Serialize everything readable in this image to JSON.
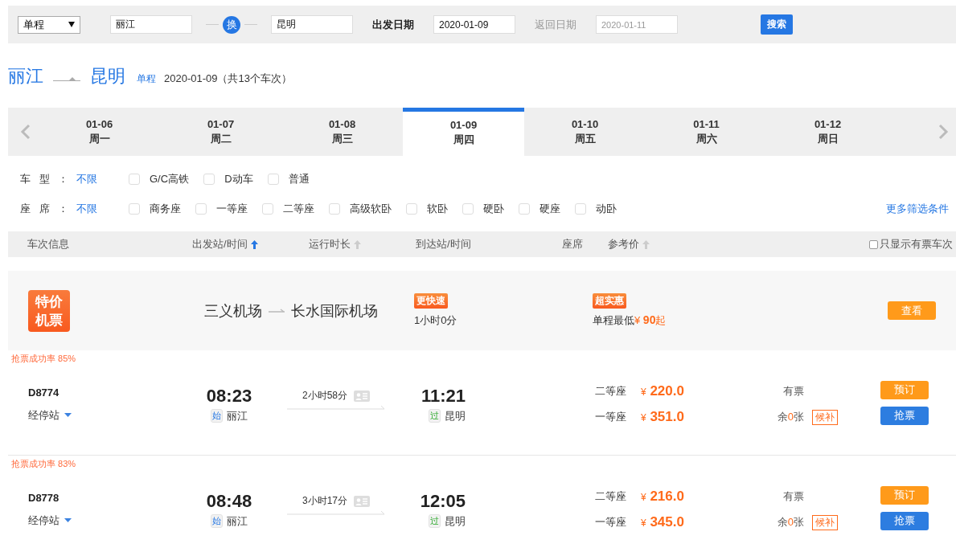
{
  "search_bar": {
    "trip_type": "单程",
    "from": "丽江",
    "swap": "换",
    "to": "昆明",
    "depart_label": "出发日期",
    "depart_date": "2020-01-09",
    "return_label": "返回日期",
    "return_date": "2020-01-11",
    "return_disabled": true,
    "search_button": "搜索"
  },
  "route": {
    "from": "丽江",
    "to": "昆明",
    "trip_type": "单程",
    "summary": "2020-01-09（共13个车次）"
  },
  "dates": [
    {
      "date": "01-06",
      "weekday": "周一",
      "selected": false
    },
    {
      "date": "01-07",
      "weekday": "周二",
      "selected": false
    },
    {
      "date": "01-08",
      "weekday": "周三",
      "selected": false
    },
    {
      "date": "01-09",
      "weekday": "周四",
      "selected": true
    },
    {
      "date": "01-10",
      "weekday": "周五",
      "selected": false
    },
    {
      "date": "01-11",
      "weekday": "周六",
      "selected": false
    },
    {
      "date": "01-12",
      "weekday": "周日",
      "selected": false
    }
  ],
  "filters": [
    {
      "label": "车型：",
      "value": "不限",
      "options": [
        {
          "label": "G/C高铁",
          "checked": false
        },
        {
          "label": "D动车",
          "checked": false
        },
        {
          "label": "普通",
          "checked": false
        }
      ]
    },
    {
      "label": "座席：",
      "value": "不限",
      "options": [
        {
          "label": "商务座",
          "checked": false
        },
        {
          "label": "一等座",
          "checked": false
        },
        {
          "label": "二等座",
          "checked": false
        },
        {
          "label": "高级软卧",
          "checked": false
        },
        {
          "label": "软卧",
          "checked": false
        },
        {
          "label": "硬卧",
          "checked": false
        },
        {
          "label": "硬座",
          "checked": false
        },
        {
          "label": "动卧",
          "checked": false
        }
      ],
      "more": "更多筛选条件"
    }
  ],
  "table_header": {
    "columns": [
      {
        "label": "车次信息"
      },
      {
        "label": "出发站/时间",
        "sort_active": true
      },
      {
        "label": "运行时长",
        "sort_active": false
      },
      {
        "label": "到达站/时间"
      },
      {
        "label": "座席"
      },
      {
        "label": "参考价",
        "sort_active": false
      }
    ],
    "only_available": {
      "label": "只显示有票车次",
      "checked": false
    }
  },
  "flight_promo": {
    "badge": "特价机票",
    "from": "三义机场",
    "to": "长水国际机场",
    "speed_tag": "更快速",
    "duration": "1小时0分",
    "price_tag": "超实惠",
    "price_label": "单程最低",
    "currency": "¥",
    "amount": "90",
    "suffix": "起",
    "button": "查看"
  },
  "trains": [
    {
      "success_rate": "抢票成功率 85%",
      "number": "D8774",
      "stops": "经停站",
      "depart_time": "08:23",
      "depart_tag": {
        "text": "始",
        "kind": "origin"
      },
      "depart_station": "丽江",
      "duration": "2小时58分",
      "arrive_time": "11:21",
      "arrive_tag": {
        "text": "过",
        "kind": "pass"
      },
      "arrive_station": "昆明",
      "seats": [
        {
          "name": "二等座",
          "currency": "¥",
          "price": "220.0",
          "kind": "status",
          "status": "有票"
        },
        {
          "name": "一等座",
          "currency": "¥",
          "price": "351.0",
          "kind": "remaining",
          "prefix": "余",
          "count": "0",
          "suffix": "张",
          "waitlist": "候补"
        }
      ],
      "buttons": [
        {
          "label": "预订",
          "kind": "book"
        },
        {
          "label": "抢票",
          "kind": "grab"
        }
      ]
    },
    {
      "success_rate": "抢票成功率 83%",
      "number": "D8778",
      "stops": "经停站",
      "depart_time": "08:48",
      "depart_tag": {
        "text": "始",
        "kind": "origin"
      },
      "depart_station": "丽江",
      "duration": "3小时17分",
      "arrive_time": "12:05",
      "arrive_tag": {
        "text": "过",
        "kind": "pass"
      },
      "arrive_station": "昆明",
      "seats": [
        {
          "name": "二等座",
          "currency": "¥",
          "price": "216.0",
          "kind": "status",
          "status": "有票"
        },
        {
          "name": "一等座",
          "currency": "¥",
          "price": "345.0",
          "kind": "remaining",
          "prefix": "余",
          "count": "0",
          "suffix": "张",
          "waitlist": "候补"
        }
      ],
      "buttons": [
        {
          "label": "预订",
          "kind": "book"
        },
        {
          "label": "抢票",
          "kind": "grab"
        }
      ]
    }
  ]
}
